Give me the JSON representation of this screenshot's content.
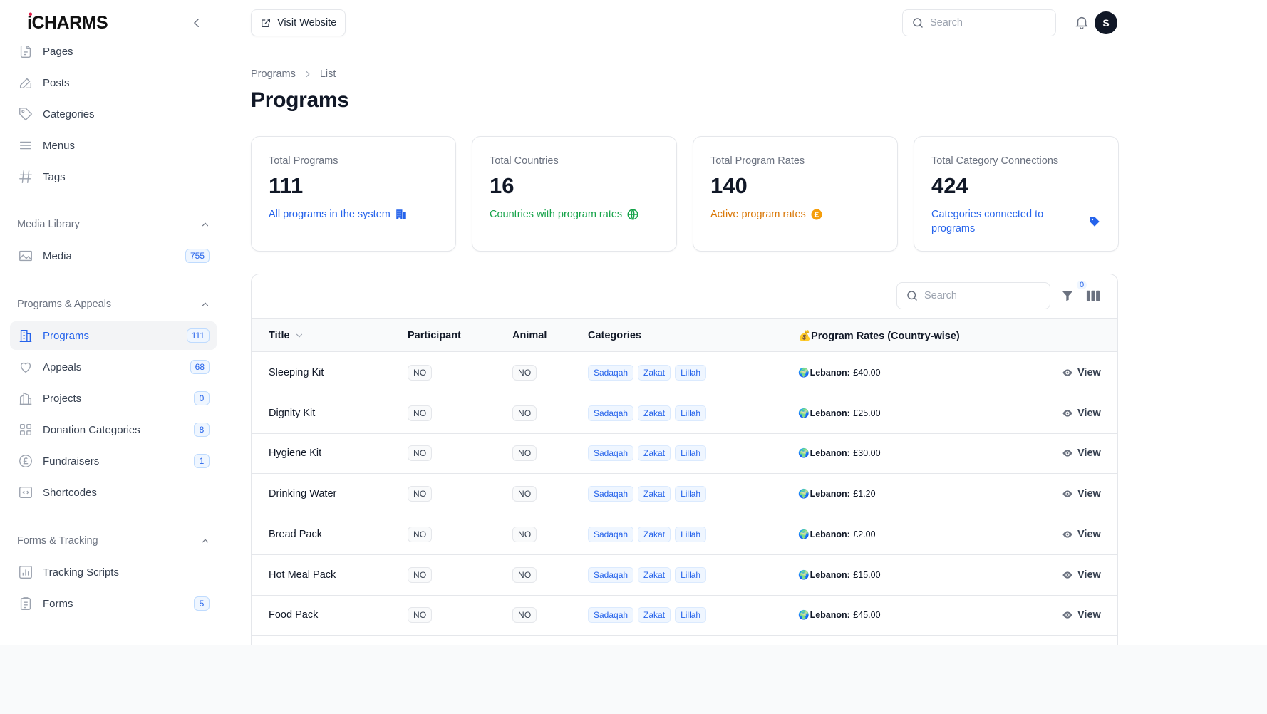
{
  "brand": {
    "name": "iCHARMS"
  },
  "sidebar": {
    "items_top": [
      {
        "label": "Pages",
        "icon": "document-icon"
      },
      {
        "label": "Posts",
        "icon": "pencil-square-icon"
      },
      {
        "label": "Categories",
        "icon": "tag-icon"
      },
      {
        "label": "Menus",
        "icon": "bars-icon"
      },
      {
        "label": "Tags",
        "icon": "hashtag-icon"
      }
    ],
    "groups": {
      "media": {
        "label": "Media Library",
        "items": [
          {
            "label": "Media",
            "icon": "photo-icon",
            "badge": "755"
          }
        ]
      },
      "programs": {
        "label": "Programs & Appeals",
        "items": [
          {
            "label": "Programs",
            "icon": "building-icon",
            "badge": "111",
            "active": true
          },
          {
            "label": "Appeals",
            "icon": "heart-icon",
            "badge": "68"
          },
          {
            "label": "Projects",
            "icon": "building-library-icon",
            "badge": "0"
          },
          {
            "label": "Donation Categories",
            "icon": "squares-icon",
            "badge": "8"
          },
          {
            "label": "Fundraisers",
            "icon": "pound-icon",
            "badge": "1"
          },
          {
            "label": "Shortcodes",
            "icon": "code-bracket-icon"
          }
        ]
      },
      "forms": {
        "label": "Forms & Tracking",
        "items": [
          {
            "label": "Tracking Scripts",
            "icon": "chart-bar-icon"
          },
          {
            "label": "Forms",
            "icon": "clipboard-icon",
            "badge": "5"
          }
        ]
      }
    }
  },
  "topbar": {
    "visit_label": "Visit Website",
    "search_placeholder": "Search",
    "avatar_initial": "S"
  },
  "breadcrumb": {
    "parent": "Programs",
    "current": "List"
  },
  "page_title": "Programs",
  "stats": [
    {
      "label": "Total Programs",
      "value": "111",
      "desc": "All programs in the system",
      "color": "#2563eb",
      "icon": "building-icon"
    },
    {
      "label": "Total Countries",
      "value": "16",
      "desc": "Countries with program rates",
      "color": "#16a34a",
      "icon": "globe-icon"
    },
    {
      "label": "Total Program Rates",
      "value": "140",
      "desc": "Active program rates",
      "color": "#d97706",
      "icon": "pound-circle-icon"
    },
    {
      "label": "Total Category Connections",
      "value": "424",
      "desc": "Categories connected to programs",
      "color": "#2563eb",
      "icon": "tag-icon"
    }
  ],
  "table": {
    "search_placeholder": "Search",
    "filter_count": "0",
    "columns": {
      "title": "Title",
      "participant": "Participant",
      "animal": "Animal",
      "categories": "Categories",
      "rates": "💰Program Rates (Country-wise)"
    },
    "view_label": "View",
    "rows": [
      {
        "title": "Sleeping Kit",
        "participant": "NO",
        "animal": "NO",
        "categories": [
          "Sadaqah",
          "Zakat",
          "Lillah"
        ],
        "rate_flag": "🌍",
        "rate_country": "Lebanon:",
        "rate_value": " £40.00"
      },
      {
        "title": "Dignity Kit",
        "participant": "NO",
        "animal": "NO",
        "categories": [
          "Sadaqah",
          "Zakat",
          "Lillah"
        ],
        "rate_flag": "🌍",
        "rate_country": "Lebanon:",
        "rate_value": " £25.00"
      },
      {
        "title": "Hygiene Kit",
        "participant": "NO",
        "animal": "NO",
        "categories": [
          "Sadaqah",
          "Zakat",
          "Lillah"
        ],
        "rate_flag": "🌍",
        "rate_country": "Lebanon:",
        "rate_value": " £30.00"
      },
      {
        "title": "Drinking Water",
        "participant": "NO",
        "animal": "NO",
        "categories": [
          "Sadaqah",
          "Zakat",
          "Lillah"
        ],
        "rate_flag": "🌍",
        "rate_country": "Lebanon:",
        "rate_value": " £1.20"
      },
      {
        "title": "Bread Pack",
        "participant": "NO",
        "animal": "NO",
        "categories": [
          "Sadaqah",
          "Zakat",
          "Lillah"
        ],
        "rate_flag": "🌍",
        "rate_country": "Lebanon:",
        "rate_value": " £2.00"
      },
      {
        "title": "Hot Meal Pack",
        "participant": "NO",
        "animal": "NO",
        "categories": [
          "Sadaqah",
          "Zakat",
          "Lillah"
        ],
        "rate_flag": "🌍",
        "rate_country": "Lebanon:",
        "rate_value": " £15.00"
      },
      {
        "title": "Food Pack",
        "participant": "NO",
        "animal": "NO",
        "categories": [
          "Sadaqah",
          "Zakat",
          "Lillah"
        ],
        "rate_flag": "🌍",
        "rate_country": "Lebanon:",
        "rate_value": " £45.00"
      }
    ]
  }
}
